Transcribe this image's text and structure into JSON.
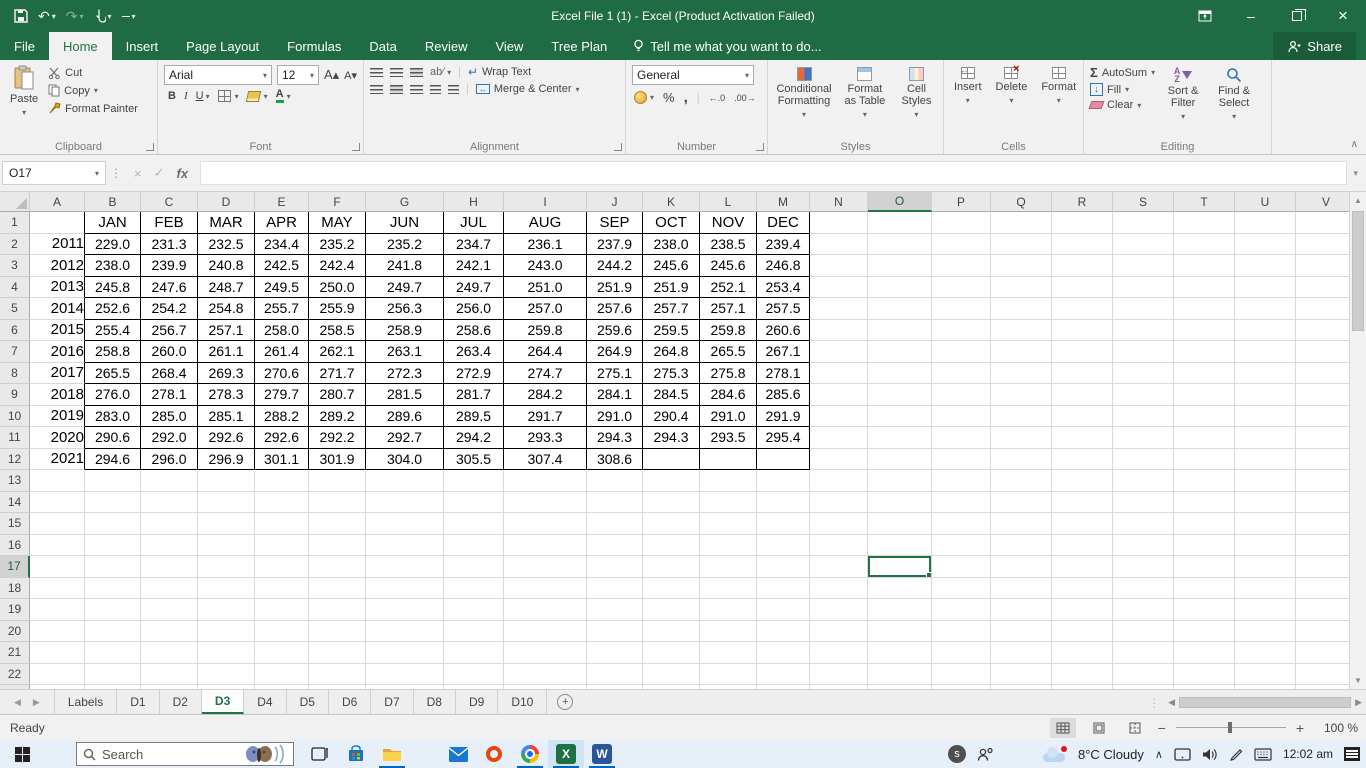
{
  "colors": {
    "excel_green": "#217346",
    "title_bar_green": "#1f6b43",
    "taskbar_blue": "#e7f0f9"
  },
  "window": {
    "title": "Excel File 1 (1) - Excel (Product Activation Failed)",
    "share": "Share",
    "tell_me": "Tell me what you want to do..."
  },
  "tabs": {
    "items": [
      "File",
      "Home",
      "Insert",
      "Page Layout",
      "Formulas",
      "Data",
      "Review",
      "View",
      "Tree Plan"
    ],
    "active": "Home"
  },
  "ribbon": {
    "clipboard": {
      "label": "Clipboard",
      "paste": "Paste",
      "cut": "Cut",
      "copy": "Copy",
      "format_painter": "Format Painter"
    },
    "font": {
      "label": "Font",
      "family": "Arial",
      "size": "12",
      "bold": "B",
      "italic": "I",
      "underline": "U"
    },
    "alignment": {
      "label": "Alignment",
      "wrap_text": "Wrap Text",
      "merge_center": "Merge & Center"
    },
    "number": {
      "label": "Number",
      "format": "General",
      "percent": "%",
      "comma": ",",
      "inc_decimal": "←.0",
      "dec_decimal": ".00→"
    },
    "styles": {
      "label": "Styles",
      "conditional": "Conditional Formatting",
      "format_table": "Format as Table",
      "cell_styles": "Cell Styles"
    },
    "cells": {
      "label": "Cells",
      "insert": "Insert",
      "delete": "Delete",
      "format": "Format"
    },
    "editing": {
      "label": "Editing",
      "autosum": "AutoSum",
      "fill": "Fill",
      "clear": "Clear",
      "sort_filter": "Sort & Filter",
      "find_select": "Find & Select"
    }
  },
  "formula_bar": {
    "name_box": "O17",
    "fx": "fx",
    "value": ""
  },
  "sheet": {
    "columns": [
      "A",
      "B",
      "C",
      "D",
      "E",
      "F",
      "G",
      "H",
      "I",
      "J",
      "K",
      "L",
      "M",
      "N",
      "O",
      "P",
      "Q",
      "R",
      "S",
      "T",
      "U",
      "V"
    ],
    "visible_rows": 23,
    "selected": {
      "col": "O",
      "row": 17
    },
    "months": [
      "JAN",
      "FEB",
      "MAR",
      "APR",
      "MAY",
      "JUN",
      "JUL",
      "AUG",
      "SEP",
      "OCT",
      "NOV",
      "DEC"
    ],
    "years": [
      "2011",
      "2012",
      "2013",
      "2014",
      "2015",
      "2016",
      "2017",
      "2018",
      "2019",
      "2020",
      "2021"
    ],
    "values": [
      [
        "229.0",
        "231.3",
        "232.5",
        "234.4",
        "235.2",
        "235.2",
        "234.7",
        "236.1",
        "237.9",
        "238.0",
        "238.5",
        "239.4"
      ],
      [
        "238.0",
        "239.9",
        "240.8",
        "242.5",
        "242.4",
        "241.8",
        "242.1",
        "243.0",
        "244.2",
        "245.6",
        "245.6",
        "246.8"
      ],
      [
        "245.8",
        "247.6",
        "248.7",
        "249.5",
        "250.0",
        "249.7",
        "249.7",
        "251.0",
        "251.9",
        "251.9",
        "252.1",
        "253.4"
      ],
      [
        "252.6",
        "254.2",
        "254.8",
        "255.7",
        "255.9",
        "256.3",
        "256.0",
        "257.0",
        "257.6",
        "257.7",
        "257.1",
        "257.5"
      ],
      [
        "255.4",
        "256.7",
        "257.1",
        "258.0",
        "258.5",
        "258.9",
        "258.6",
        "259.8",
        "259.6",
        "259.5",
        "259.8",
        "260.6"
      ],
      [
        "258.8",
        "260.0",
        "261.1",
        "261.4",
        "262.1",
        "263.1",
        "263.4",
        "264.4",
        "264.9",
        "264.8",
        "265.5",
        "267.1"
      ],
      [
        "265.5",
        "268.4",
        "269.3",
        "270.6",
        "271.7",
        "272.3",
        "272.9",
        "274.7",
        "275.1",
        "275.3",
        "275.8",
        "278.1"
      ],
      [
        "276.0",
        "278.1",
        "278.3",
        "279.7",
        "280.7",
        "281.5",
        "281.7",
        "284.2",
        "284.1",
        "284.5",
        "284.6",
        "285.6"
      ],
      [
        "283.0",
        "285.0",
        "285.1",
        "288.2",
        "289.2",
        "289.6",
        "289.5",
        "291.7",
        "291.0",
        "290.4",
        "291.0",
        "291.9"
      ],
      [
        "290.6",
        "292.0",
        "292.6",
        "292.6",
        "292.2",
        "292.7",
        "294.2",
        "293.3",
        "294.3",
        "294.3",
        "293.5",
        "295.4"
      ],
      [
        "294.6",
        "296.0",
        "296.9",
        "301.1",
        "301.9",
        "304.0",
        "305.5",
        "307.4",
        "308.6",
        "",
        "",
        ""
      ]
    ]
  },
  "sheet_tabs": {
    "items": [
      "Labels",
      "D1",
      "D2",
      "D3",
      "D4",
      "D5",
      "D6",
      "D7",
      "D8",
      "D9",
      "D10"
    ],
    "active": "D3"
  },
  "status_bar": {
    "mode": "Ready",
    "zoom": "100 %"
  },
  "taskbar": {
    "search": "Search",
    "weather": "8°C Cloudy",
    "time": "12:02 am",
    "tray_badge": "s"
  }
}
